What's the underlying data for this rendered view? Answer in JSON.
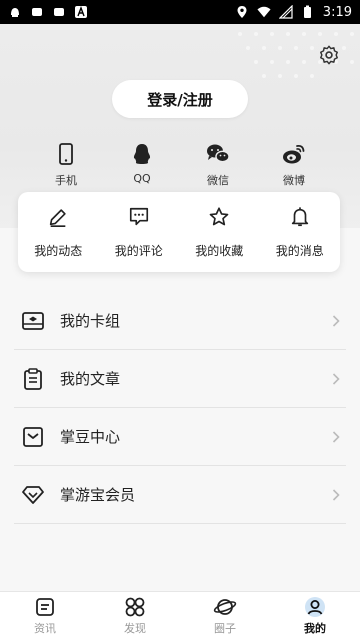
{
  "status_bar": {
    "time": "3:19"
  },
  "header": {
    "login_button": "登录/注册",
    "social": [
      {
        "label": "手机",
        "icon": "phone-icon"
      },
      {
        "label": "QQ",
        "icon": "qq-icon"
      },
      {
        "label": "微信",
        "icon": "wechat-icon"
      },
      {
        "label": "微博",
        "icon": "weibo-icon"
      }
    ]
  },
  "quick_actions": [
    {
      "label": "我的动态",
      "icon": "pencil-icon"
    },
    {
      "label": "我的评论",
      "icon": "comment-icon"
    },
    {
      "label": "我的收藏",
      "icon": "star-icon"
    },
    {
      "label": "我的消息",
      "icon": "bell-icon"
    }
  ],
  "menu": [
    {
      "label": "我的卡组",
      "icon": "card-group-icon"
    },
    {
      "label": "我的文章",
      "icon": "article-icon"
    },
    {
      "label": "掌豆中心",
      "icon": "bean-icon"
    },
    {
      "label": "掌游宝会员",
      "icon": "diamond-icon"
    }
  ],
  "bottom_nav": [
    {
      "label": "资讯",
      "icon": "news-icon",
      "active": false
    },
    {
      "label": "发现",
      "icon": "discover-icon",
      "active": false
    },
    {
      "label": "圈子",
      "icon": "circle-icon",
      "active": false
    },
    {
      "label": "我的",
      "icon": "profile-icon",
      "active": true
    }
  ],
  "colors": {
    "accent": "#111111",
    "inactive": "#999999"
  }
}
